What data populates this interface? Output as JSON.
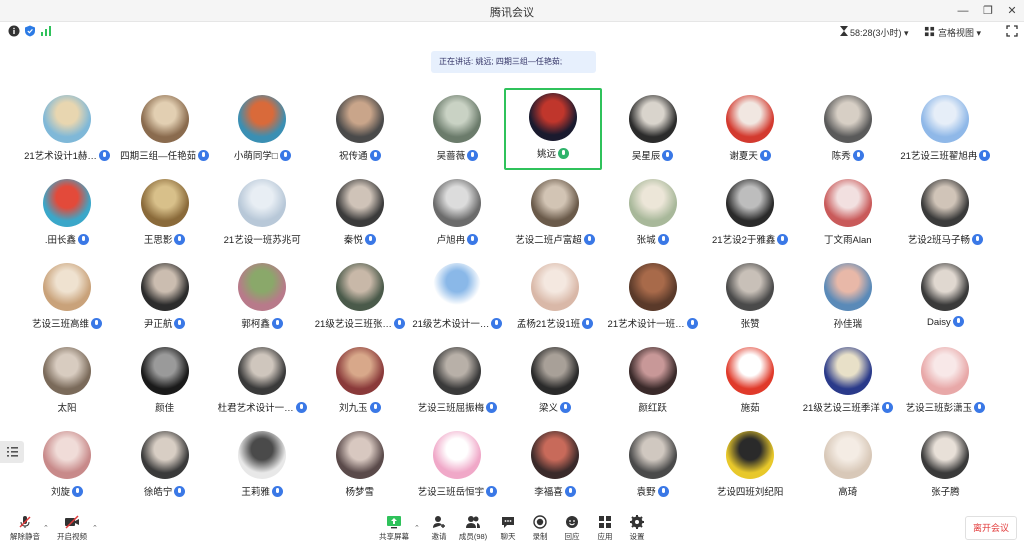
{
  "window": {
    "title": "腾讯会议"
  },
  "toolbar": {
    "timer": "58:28(3小时)",
    "view_label": "宫格视图"
  },
  "speaking_banner": "正在讲话: 姚远; 四期三组—任艳茹;",
  "participants": [
    {
      "name": "21艺术设计1赫…",
      "mic": "blue",
      "c1": "#7fb8d8",
      "c2": "#e8d6b0"
    },
    {
      "name": "四期三组—任艳茹",
      "mic": "blue",
      "c1": "#8a6b4e",
      "c2": "#e2cfb2"
    },
    {
      "name": "小萌同学□",
      "mic": "blue",
      "c1": "#3a8fb3",
      "c2": "#d96a3a"
    },
    {
      "name": "祝传通",
      "mic": "blue",
      "c1": "#4a4a4a",
      "c2": "#c9a58a"
    },
    {
      "name": "吴蔷薇",
      "mic": "blue",
      "c1": "#6b7b6b",
      "c2": "#c9d2c4"
    },
    {
      "name": "姚远",
      "mic": "green",
      "c1": "#1a1a2e",
      "c2": "#c0362c",
      "active": true
    },
    {
      "name": "吴星辰",
      "mic": "blue",
      "c1": "#2b2b2b",
      "c2": "#d9d4cc"
    },
    {
      "name": "谢夏天",
      "mic": "blue",
      "c1": "#d33a2f",
      "c2": "#f1e7e1"
    },
    {
      "name": "陈秀",
      "mic": "blue",
      "c1": "#5a5a5a",
      "c2": "#d7cfc5"
    },
    {
      "name": "21艺设三班翟旭冉",
      "mic": "blue",
      "c1": "#8fb8e8",
      "c2": "#e6eef8"
    },
    {
      "name": ".田长鑫",
      "mic": "blue",
      "c1": "#3aa7c9",
      "c2": "#e34a3a"
    },
    {
      "name": "王思影",
      "mic": "blue",
      "c1": "#8a6a3a",
      "c2": "#d8c08a"
    },
    {
      "name": "21艺设一班苏兆可",
      "mic": "none",
      "c1": "#b8c8d8",
      "c2": "#e8eef4"
    },
    {
      "name": "秦悦",
      "mic": "blue",
      "c1": "#3b3b3b",
      "c2": "#cfc3b8"
    },
    {
      "name": "卢旭冉",
      "mic": "blue",
      "c1": "#6b6b6b",
      "c2": "#dcdcdc"
    },
    {
      "name": "艺设二班卢富超",
      "mic": "blue",
      "c1": "#6a5a4a",
      "c2": "#d2c4b4"
    },
    {
      "name": "张城",
      "mic": "blue",
      "c1": "#a8b89a",
      "c2": "#ece6d8"
    },
    {
      "name": "21艺设2于雅鑫",
      "mic": "blue",
      "c1": "#2a2a2a",
      "c2": "#bdbdbd"
    },
    {
      "name": "丁文雨Alan",
      "mic": "none",
      "c1": "#c95a5a",
      "c2": "#f2e0e0"
    },
    {
      "name": "艺设2班马子畅",
      "mic": "blue",
      "c1": "#3a3a3a",
      "c2": "#d0c4b8"
    },
    {
      "name": "艺设三班高维",
      "mic": "blue",
      "c1": "#c9a27a",
      "c2": "#efe2d0"
    },
    {
      "name": "尹正航",
      "mic": "blue",
      "c1": "#2c2c2c",
      "c2": "#cbbdb0"
    },
    {
      "name": "郭柯鑫",
      "mic": "blue",
      "c1": "#b87a8a",
      "c2": "#8aa86a"
    },
    {
      "name": "21级艺设三班张…",
      "mic": "blue",
      "c1": "#4a5a4a",
      "c2": "#c8b8a8"
    },
    {
      "name": "21级艺术设计一…",
      "mic": "blue",
      "c1": "#ffffff",
      "c2": "#8ab8e8"
    },
    {
      "name": "孟杨21艺设1班",
      "mic": "blue",
      "c1": "#d9b8a8",
      "c2": "#f4e8e0"
    },
    {
      "name": "21艺术设计一班…",
      "mic": "blue",
      "c1": "#5a3a2a",
      "c2": "#a86a4a"
    },
    {
      "name": "张赞",
      "mic": "none",
      "c1": "#4a4a4a",
      "c2": "#c8c0b8"
    },
    {
      "name": "孙佳瑞",
      "mic": "none",
      "c1": "#5a8ab8",
      "c2": "#e8b8a8"
    },
    {
      "name": "Daisy",
      "mic": "blue",
      "c1": "#3a3a3a",
      "c2": "#e0d8d0"
    },
    {
      "name": "太阳",
      "mic": "none",
      "c1": "#7a6a5a",
      "c2": "#d8ccc0"
    },
    {
      "name": "颜佳",
      "mic": "none",
      "c1": "#1a1a1a",
      "c2": "#9a9a9a"
    },
    {
      "name": "杜君艺术设计一…",
      "mic": "blue",
      "c1": "#3a3a3a",
      "c2": "#cfc6bd"
    },
    {
      "name": "刘九玉",
      "mic": "blue",
      "c1": "#8a3a3a",
      "c2": "#d8a88a"
    },
    {
      "name": "艺设三班屈振梅",
      "mic": "blue",
      "c1": "#3a3a3a",
      "c2": "#b8b0a8"
    },
    {
      "name": "梁义",
      "mic": "blue",
      "c1": "#2a2a2a",
      "c2": "#a8a098"
    },
    {
      "name": "颜红跃",
      "mic": "none",
      "c1": "#3a2a2a",
      "c2": "#c89898"
    },
    {
      "name": "施茹",
      "mic": "none",
      "c1": "#e03a2a",
      "c2": "#ffffff"
    },
    {
      "name": "21级艺设三班季洋",
      "mic": "blue",
      "c1": "#2a3a8a",
      "c2": "#e8e0c8"
    },
    {
      "name": "艺设三班彭潇玉",
      "mic": "blue",
      "c1": "#e8a8a8",
      "c2": "#f8e8e8"
    },
    {
      "name": "刘旋",
      "mic": "blue",
      "c1": "#c88a8a",
      "c2": "#f0dcd8"
    },
    {
      "name": "徐皓宁",
      "mic": "blue",
      "c1": "#3a3a3a",
      "c2": "#d8cec4"
    },
    {
      "name": "王莉雅",
      "mic": "blue",
      "c1": "#e8e8e8",
      "c2": "#4a4a4a"
    },
    {
      "name": "杨梦雪",
      "mic": "none",
      "c1": "#5a4a4a",
      "c2": "#d8c8c0"
    },
    {
      "name": "艺设三班岳恒宇",
      "mic": "blue",
      "c1": "#f0a8c8",
      "c2": "#ffffff"
    },
    {
      "name": "李福喜",
      "mic": "blue",
      "c1": "#3a2a2a",
      "c2": "#c86a5a"
    },
    {
      "name": "袁野",
      "mic": "blue",
      "c1": "#4a4a4a",
      "c2": "#d0c8c0"
    },
    {
      "name": "艺设四班刘纪阳",
      "mic": "none",
      "c1": "#e8c82a",
      "c2": "#2a2a2a"
    },
    {
      "name": "高琦",
      "mic": "none",
      "c1": "#d8c8b8",
      "c2": "#f4ece4"
    },
    {
      "name": "张子腾",
      "mic": "none",
      "c1": "#3a3a3a",
      "c2": "#e8e0d8"
    }
  ],
  "bottom": {
    "unmute": "解除静音",
    "start_video": "开启视频",
    "share": "共享屏幕",
    "invite": "邀请",
    "members": "成员(98)",
    "chat": "聊天",
    "record": "录制",
    "reactions": "回应",
    "apps": "应用",
    "settings": "设置",
    "leave": "离开会议"
  },
  "colors": {
    "accent": "#3a78e6",
    "active_border": "#2fc25b",
    "leave": "#e23b3b"
  }
}
